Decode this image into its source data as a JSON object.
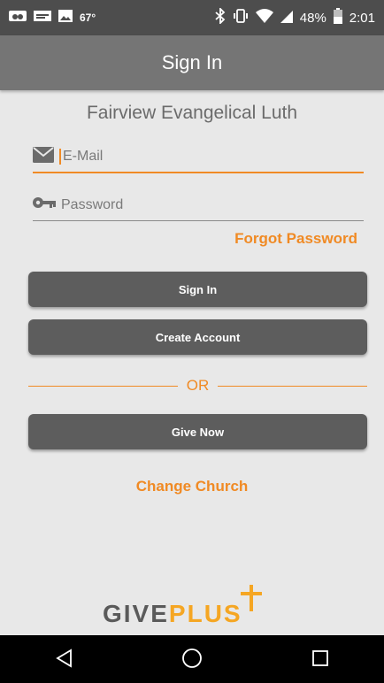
{
  "status_bar": {
    "temperature": "67°",
    "battery": "48%",
    "time": "2:01"
  },
  "header": {
    "title": "Sign In"
  },
  "church_name": "Fairview Evangelical Luth",
  "form": {
    "email_placeholder": "E-Mail",
    "email_value": "",
    "password_placeholder": "Password",
    "password_value": "",
    "forgot_label": "Forgot Password"
  },
  "buttons": {
    "sign_in": "Sign In",
    "create_account": "Create Account",
    "or": "OR",
    "give_now": "Give Now"
  },
  "change_church": "Change Church",
  "logo": {
    "give": "GIVE",
    "plus": "PLUS"
  },
  "colors": {
    "accent": "#f08a24",
    "button": "#5d5d5d",
    "app_bar": "#757575",
    "status_bar": "#4d4d4d",
    "background": "#e8e8e8",
    "logo_orange": "#f5a623"
  },
  "icons": {
    "status_left": [
      "gallery-icon",
      "news-icon",
      "image-icon"
    ],
    "status_right": [
      "bluetooth-icon",
      "vibrate-icon",
      "wifi-icon",
      "signal-icon",
      "battery-icon"
    ],
    "email": "envelope-icon",
    "password": "key-icon",
    "nav": [
      "back-icon",
      "home-icon",
      "recents-icon"
    ]
  }
}
